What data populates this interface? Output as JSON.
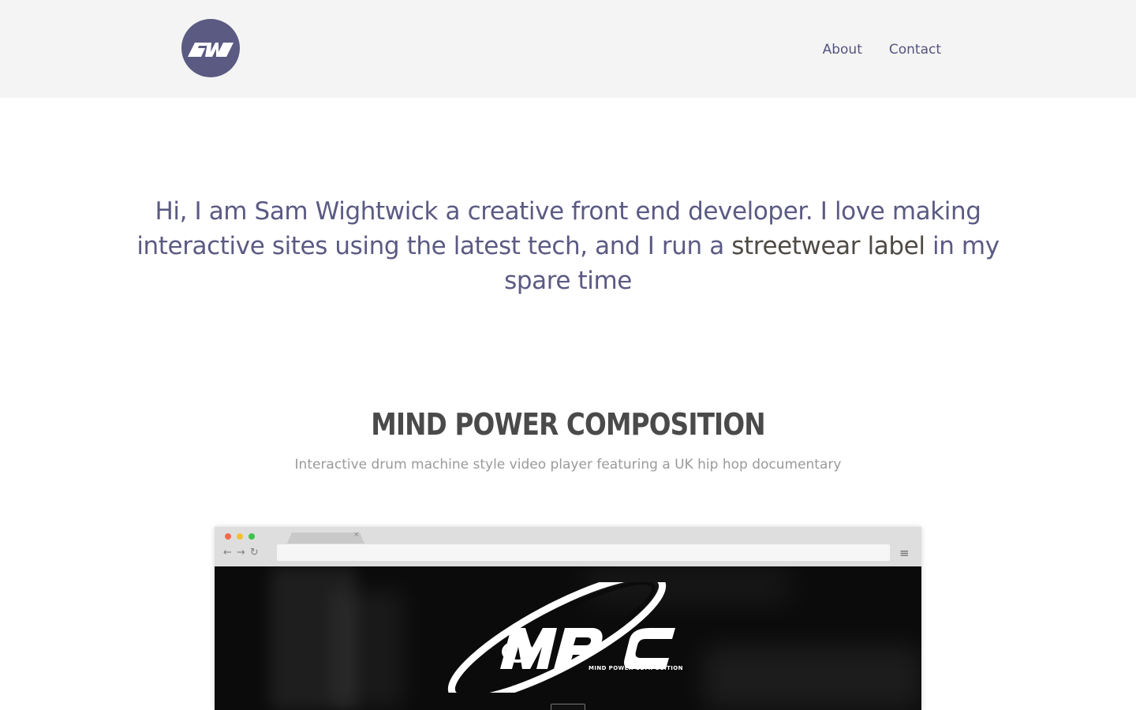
{
  "header": {
    "logo_text": "SW",
    "nav": [
      {
        "label": "About"
      },
      {
        "label": "Contact"
      }
    ]
  },
  "intro": {
    "text_before": "Hi, I am Sam Wightwick a creative front end developer. I love making interactive sites using the latest tech, and I run a ",
    "highlight": "streetwear label",
    "text_after": " in my spare time"
  },
  "project": {
    "title": "MIND POWER COMPOSITION",
    "description": "Interactive drum machine style video player featuring a UK hip hop documentary",
    "preview": {
      "tab_close": "×",
      "nav_icons": [
        "←",
        "→",
        "↻"
      ],
      "menu_icon": "≡",
      "logo_text": "MPC",
      "logo_subtitle": "MIND POWER COMPOSITION"
    }
  },
  "colors": {
    "brand": "#5b5a83",
    "header_bg": "#f4f4f4",
    "title": "#4a4a4a",
    "muted": "#9a9a9a"
  }
}
